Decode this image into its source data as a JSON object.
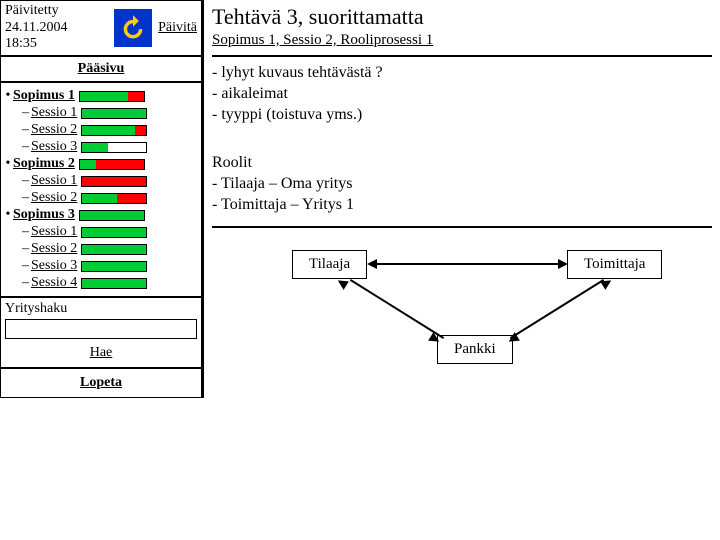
{
  "updated": {
    "label": "Päivitetty",
    "date": "24.11.2004",
    "time": "18:35",
    "refresh": "Päivitä"
  },
  "paasivu": "Pääsivu",
  "nav": {
    "s1": "Sopimus 1",
    "s1_1": "Sessio 1",
    "s1_2": "Sessio 2",
    "s1_3": "Sessio 3",
    "s2": "Sopimus 2",
    "s2_1": "Sessio 1",
    "s2_2": "Sessio 2",
    "s3": "Sopimus 3",
    "s3_1": "Sessio 1",
    "s3_2": "Sessio 2",
    "s3_3": "Sessio 3",
    "s3_4": "Sessio 4"
  },
  "search": {
    "label": "Yrityshaku",
    "button": "Hae",
    "value": ""
  },
  "lopeta": "Lopeta",
  "main": {
    "title": "Tehtävä 3, suorittamatta",
    "breadcrumb": "Sopimus 1, Sessio 2, Rooliprosessi 1",
    "desc1": "- lyhyt kuvaus tehtävästä ?",
    "desc2": "- aikaleimat",
    "desc3": "- tyyppi (toistuva yms.)",
    "roles_h": "Roolit",
    "role1": "- Tilaaja – Oma yritys",
    "role2": "- Toimittaja – Yritys 1"
  },
  "diagram": {
    "n1": "Tilaaja",
    "n2": "Toimittaja",
    "n3": "Pankki"
  }
}
